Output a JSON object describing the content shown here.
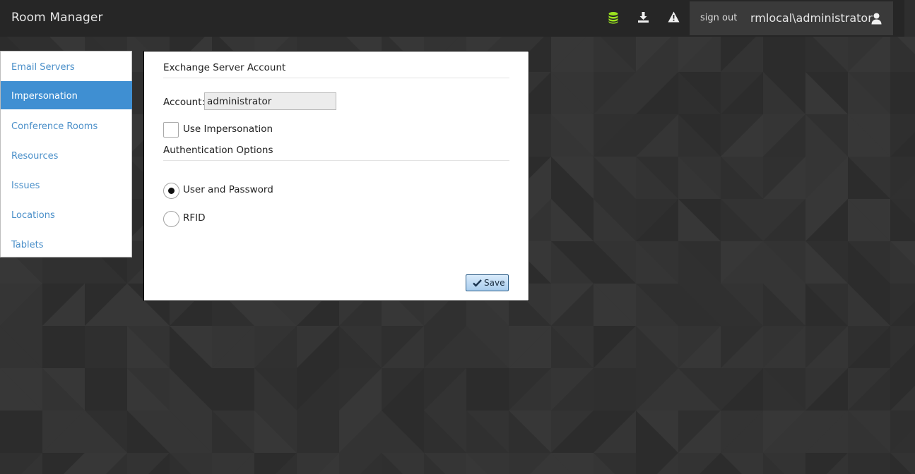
{
  "app": {
    "title": "Room Manager"
  },
  "header": {
    "icons": [
      "database-icon",
      "download-icon",
      "warning-icon",
      "user-icon"
    ],
    "sign_out": "sign out",
    "username": "rmlocal\\administrator",
    "db_icon_color": "#9be31f"
  },
  "sidebar": {
    "items": [
      {
        "label": "Email Servers",
        "active": false
      },
      {
        "label": "Impersonation",
        "active": true
      },
      {
        "label": "Conference Rooms",
        "active": false
      },
      {
        "label": "Resources",
        "active": false
      },
      {
        "label": "Issues",
        "active": false
      },
      {
        "label": "Locations",
        "active": false
      },
      {
        "label": "Tablets",
        "active": false
      }
    ]
  },
  "panel": {
    "section_account": "Exchange Server Account",
    "account_label": "Account:",
    "account_value": "administrator",
    "use_impersonation_label": "Use Impersonation",
    "use_impersonation_checked": false,
    "section_auth": "Authentication Options",
    "auth_options": [
      {
        "label": "User and Password",
        "selected": true
      },
      {
        "label": "RFID",
        "selected": false
      }
    ],
    "save_label": "Save"
  },
  "colors": {
    "header_bg": "#262626",
    "active_nav_bg": "#3f8fd2",
    "nav_link": "#4a8fc9",
    "page_bg": "#323232"
  }
}
